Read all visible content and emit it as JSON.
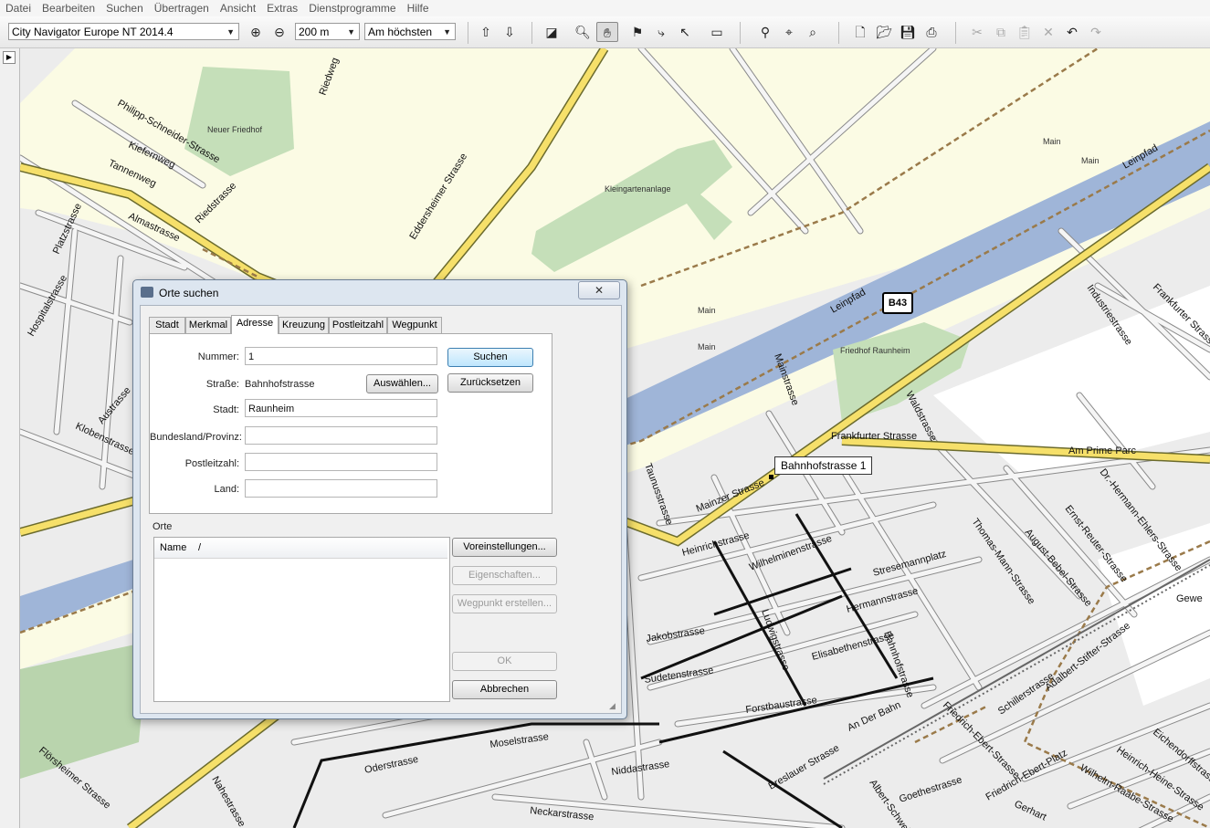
{
  "menu": [
    "Datei",
    "Bearbeiten",
    "Suchen",
    "Übertragen",
    "Ansicht",
    "Extras",
    "Dienstprogramme",
    "Hilfe"
  ],
  "toolbar": {
    "map_product": "City Navigator Europe NT 2014.4",
    "zoom_scale": "200 m",
    "detail": "Am höchsten"
  },
  "map": {
    "road_shield": "B43",
    "callout": "Bahnhofstrasse 1",
    "labels": [
      {
        "text": "Neuer Friedhof"
      },
      {
        "text": "Kleingartenanlage"
      },
      {
        "text": "Main"
      },
      {
        "text": "Main"
      },
      {
        "text": "Main"
      },
      {
        "text": "Main"
      },
      {
        "text": "Friedhof Raunheim"
      },
      {
        "text": "Leinpfad"
      },
      {
        "text": "Leinpfad"
      },
      {
        "text": "Frankfurter Strasse"
      },
      {
        "text": "Am Prime Parc"
      },
      {
        "text": "Mainzer Strasse"
      },
      {
        "text": "Heinrichstrasse"
      },
      {
        "text": "Wilhelminenstrasse"
      },
      {
        "text": "Stresemannplatz"
      },
      {
        "text": "Hermannstrasse"
      },
      {
        "text": "Jakobstrasse"
      },
      {
        "text": "Elisabethenstrasse"
      },
      {
        "text": "Sudetenstrasse"
      },
      {
        "text": "Forstbaustrasse"
      },
      {
        "text": "Moselstrasse"
      },
      {
        "text": "Oderstrasse"
      },
      {
        "text": "Niddastrasse"
      },
      {
        "text": "Neckarstrasse"
      },
      {
        "text": "Eddersheimer Strasse"
      },
      {
        "text": "Riedstrasse"
      },
      {
        "text": "Riedweg"
      },
      {
        "text": "Kiefernweg"
      },
      {
        "text": "Tannenweg"
      },
      {
        "text": "Almastrasse"
      },
      {
        "text": "Philipp-Schneider-Strasse"
      },
      {
        "text": "Platzstrasse"
      },
      {
        "text": "Hospitalstrasse"
      },
      {
        "text": "Austrasse"
      },
      {
        "text": "Klobenstrasse"
      },
      {
        "text": "Mainstrasse"
      },
      {
        "text": "Waldstrasse"
      },
      {
        "text": "Industriestrasse"
      },
      {
        "text": "Frankfurter Strasse"
      },
      {
        "text": "Thomas-Mann-Strasse"
      },
      {
        "text": "August-Bebel-Strasse"
      },
      {
        "text": "Ernst-Reuter-Strasse"
      },
      {
        "text": "Dr.-Hermann-Ehlers-Strasse"
      },
      {
        "text": "Schillerstrasse"
      },
      {
        "text": "Adalbert-Stifter-Strasse"
      },
      {
        "text": "Friedrich-Ebert-Strasse"
      },
      {
        "text": "Friedrich-Ebert-Platz"
      },
      {
        "text": "Wilhelm-Raabe-Strasse"
      },
      {
        "text": "Heinrich-Heine-Strasse"
      },
      {
        "text": "Eichendorffstrasse"
      },
      {
        "text": "Goethestrasse"
      },
      {
        "text": "Albert-Schweitzer"
      },
      {
        "text": "Breslauer Strasse"
      },
      {
        "text": "An Der Bahn"
      },
      {
        "text": "Bahnhofstrasse"
      },
      {
        "text": "Ludwigstrasse"
      },
      {
        "text": "Taunusstrasse"
      },
      {
        "text": "Flörsheimer Strasse"
      },
      {
        "text": "Nahestrasse"
      },
      {
        "text": "Gerhart"
      },
      {
        "text": "Gewe"
      }
    ]
  },
  "dialog": {
    "title": "Orte suchen",
    "close": "✕",
    "tabs": [
      "Stadt",
      "Merkmal",
      "Adresse",
      "Kreuzung",
      "Postleitzahl",
      "Wegpunkt"
    ],
    "fields": {
      "nummer_label": "Nummer:",
      "nummer_value": "1",
      "strasse_label": "Straße:",
      "strasse_value": "Bahnhofstrasse",
      "stadt_label": "Stadt:",
      "stadt_value": "Raunheim",
      "bundesland_label": "Bundesland/Provinz:",
      "bundesland_value": "",
      "plz_label": "Postleitzahl:",
      "plz_value": "",
      "land_label": "Land:",
      "land_value": ""
    },
    "buttons": {
      "suchen": "Suchen",
      "auswaehlen": "Auswählen...",
      "zuruecksetzen": "Zurücksetzen",
      "voreinstellungen": "Voreinstellungen...",
      "eigenschaften": "Eigenschaften...",
      "wegpunkt_erstellen": "Wegpunkt erstellen...",
      "ok": "OK",
      "abbrechen": "Abbrechen"
    },
    "orte_label": "Orte",
    "list_header": {
      "name": "Name",
      "sort": "/"
    }
  }
}
